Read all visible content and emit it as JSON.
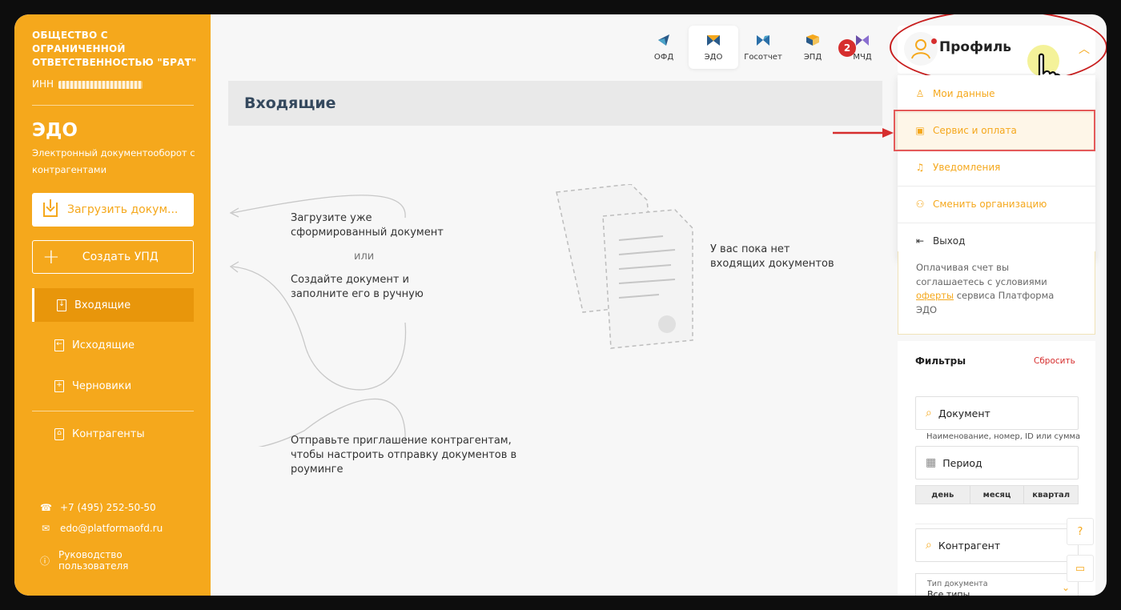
{
  "sidebar": {
    "org_name": "ОБЩЕСТВО С ОГРАНИЧЕННОЙ ОТВЕТСТВЕННОСТЬЮ \"БРАТ\"",
    "inn_label": "ИНН",
    "app_title": "ЭДО",
    "app_subtitle": "Электронный документооборот с контрагентами",
    "upload_button": "Загрузить докум...",
    "create_button": "Создать УПД",
    "nav": [
      {
        "label": "Входящие",
        "active": true
      },
      {
        "label": "Исходящие",
        "active": false
      },
      {
        "label": "Черновики",
        "active": false
      },
      {
        "label": "Контрагенты",
        "active": false
      }
    ],
    "phone": "+7 (495) 252-50-50",
    "email": "edo@platformaofd.ru",
    "guide": "Руководство пользователя"
  },
  "tabs": [
    {
      "label": "ОФД",
      "color": "#2a5b8a"
    },
    {
      "label": "ЭДО",
      "color": "#f5a81c",
      "active": true
    },
    {
      "label": "Госотчет",
      "color": "#2a6fa8"
    },
    {
      "label": "ЭПД",
      "color": "#f5a81c"
    },
    {
      "label": "МЧД",
      "color": "#6a4fa8"
    }
  ],
  "annotation_number": "2",
  "main": {
    "page_title": "Входящие",
    "hint_upload": "Загрузите уже сформированный документ",
    "hint_or": "или",
    "hint_create": "Создайте документ и заполните его в ручную",
    "hint_invite": "Отправьте приглашение контрагентам, чтобы настроить отправку документов в роуминге",
    "empty_text": "У вас пока нет входящих документов"
  },
  "profile": {
    "label": "Профиль",
    "menu": [
      {
        "label": "Мои данные",
        "icon": "user-icon"
      },
      {
        "label": "Сервис и оплата",
        "icon": "wallet-icon",
        "highlighted": true
      },
      {
        "label": "Уведомления",
        "icon": "bell-icon"
      },
      {
        "label": "Сменить организацию",
        "icon": "users-icon"
      },
      {
        "label": "Выход",
        "icon": "logout-icon"
      }
    ]
  },
  "offer": {
    "text_before": "Оплачивая счет вы соглашаетесь с условиями",
    "link": "оферты",
    "text_after": "сервиса Платформа ЭДО"
  },
  "filters": {
    "title": "Фильтры",
    "reset": "Сбросить",
    "document_placeholder": "Документ",
    "document_hint": "Наименование, номер, ID или сумма",
    "period_placeholder": "Период",
    "period_options": [
      "день",
      "месяц",
      "квартал"
    ],
    "counterparty_placeholder": "Контрагент",
    "doc_type_label": "Тип документа",
    "doc_type_value": "Все типы"
  }
}
